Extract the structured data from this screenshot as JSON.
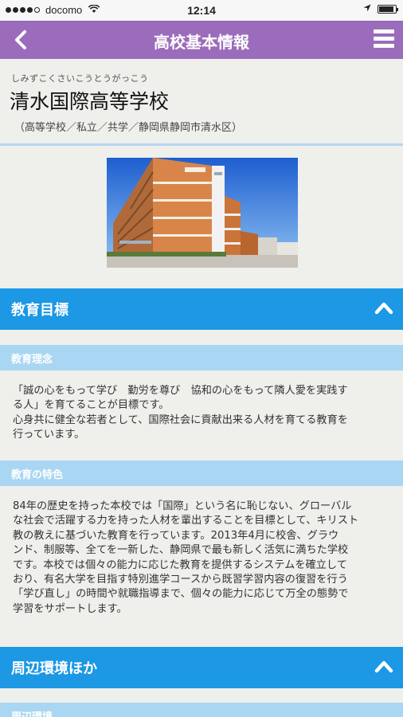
{
  "status_bar": {
    "carrier": "docomo",
    "time": "12:14"
  },
  "nav": {
    "back_label": "‹",
    "title": "高校基本情報"
  },
  "school": {
    "furigana": "しみずこくさいこうとうがっこう",
    "name": "清水国際高等学校",
    "meta": "（高等学校／私立／共学／静岡県静岡市清水区）"
  },
  "sections": {
    "education_goals": {
      "title": "教育目標",
      "philosophy": {
        "title": "教育理念",
        "lines": [
          "「誠の心をもって学び　勤労を尊び　協和の心をもって隣人愛を実践す",
          "る人」を育てることが目標です。",
          "心身共に健全な若者として、国際社会に貢献出来る人材を育てる教育を",
          "行っています。"
        ]
      },
      "features": {
        "title": "教育の特色",
        "lines": [
          "84年の歴史を持った本校では「国際」という名に恥じない、グローバル",
          "な社会で活躍する力を持った人材を輩出することを目標として、キリスト",
          "教の教えに基づいた教育を行っています。2013年4月に校舎、グラウ",
          "ンド、制服等、全てを一新した、静岡県で最も新しく活気に満ちた学校",
          "です。本校では個々の能力に応じた教育を提供するシステムを確立して",
          "おり、有名大学を目指す特別進学コースから既習学習内容の復習を行う",
          "「学び直し」の時間や就職指導まで、個々の能力に応じて万全の態勢で",
          "学習をサポートします。"
        ]
      }
    },
    "surroundings": {
      "title": "周辺環境ほか",
      "sub_title": "周辺環境"
    }
  },
  "colors": {
    "nav_bg": "#9b6cbb",
    "section_bg": "#1c98e4",
    "subsection_bg": "#a9d7f3",
    "page_bg": "#efefec"
  }
}
